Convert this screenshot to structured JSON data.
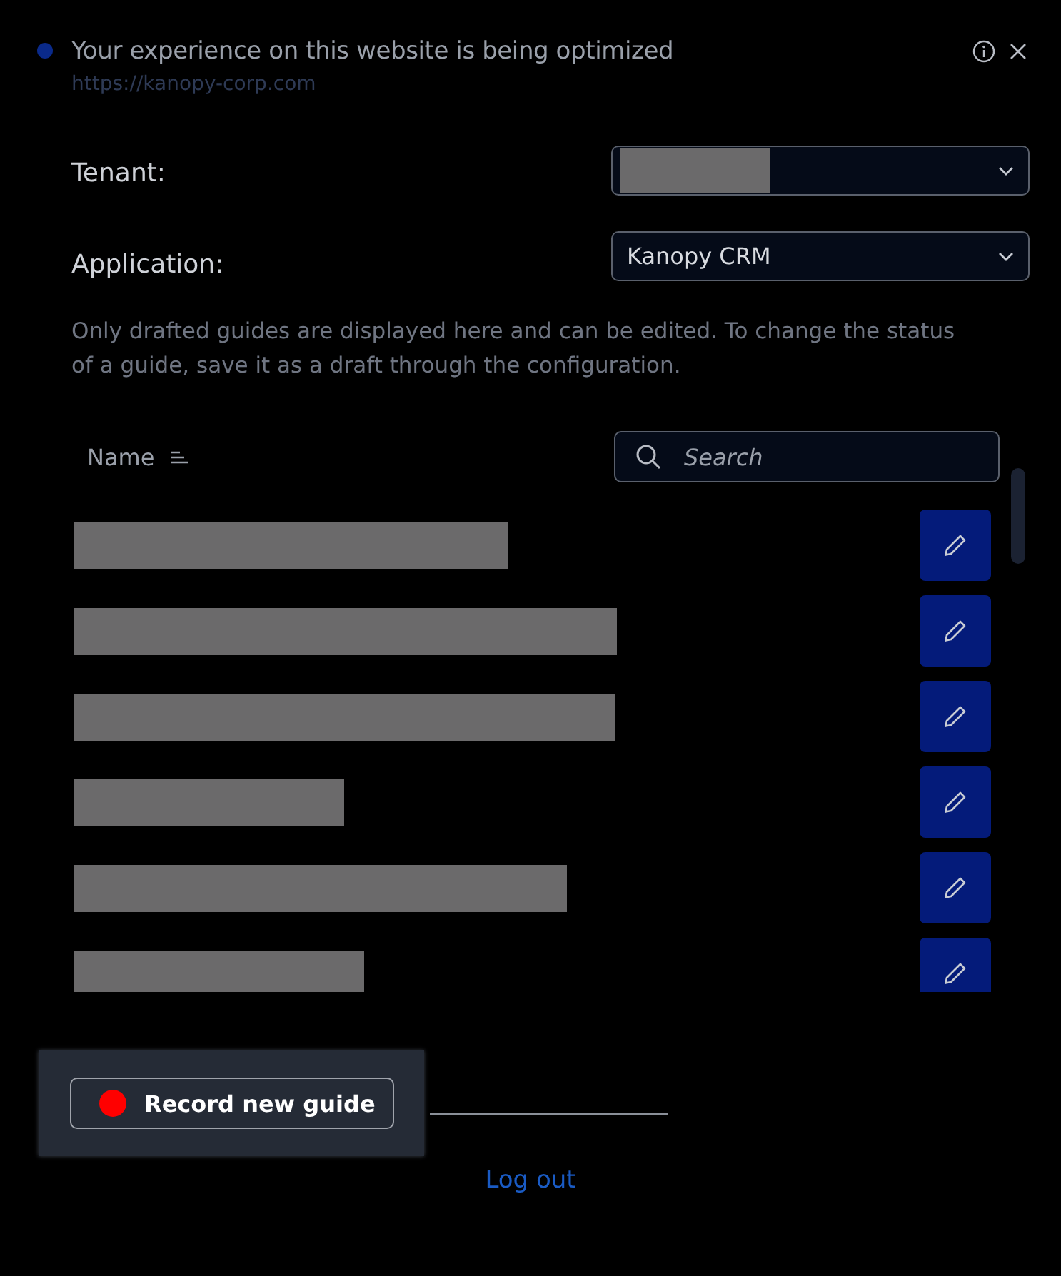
{
  "notification": {
    "title": "Your experience on this website is being optimized",
    "url": "https://kanopy-corp.com"
  },
  "fields": [
    {
      "label": "Tenant:",
      "redacted": true
    },
    {
      "label": "Application:",
      "value": "Kanopy CRM"
    }
  ],
  "description": "Only drafted guides are displayed here and can be edited. To change the status of a guide, save it as a draft through the configuration.",
  "list": {
    "column": "Name",
    "search": {
      "placeholder": "Search"
    },
    "rows": [
      {
        "redacted": true
      },
      {
        "redacted": true
      },
      {
        "redacted": true
      },
      {
        "redacted": true
      },
      {
        "redacted": true
      },
      {
        "redacted": true
      }
    ]
  },
  "record_button": "Record new guide",
  "logout": "Log out"
}
